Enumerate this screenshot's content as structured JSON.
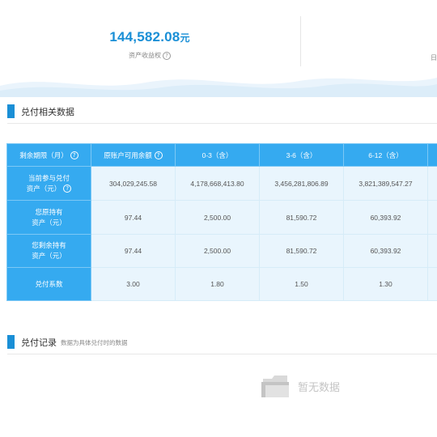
{
  "summary": {
    "amount": "144,582.08",
    "unit": "元",
    "label": "资产收益权",
    "right_stub": "日"
  },
  "sections": {
    "data_title": "兑付相关数据",
    "records_title": "兑付记录",
    "records_subtitle": "数据为具体兑付时的数据"
  },
  "table": {
    "headers": [
      "剩余期限（月）",
      "原账户可用余额",
      "0-3（含）",
      "3-6（含）",
      "6-12（含）",
      ""
    ],
    "rows": [
      {
        "label_line1": "当前参与兑付",
        "label_line2": "资产（元）",
        "values": [
          "304,029,245.58",
          "4,178,668,413.80",
          "3,456,281,806.89",
          "3,821,389,547.27",
          ""
        ]
      },
      {
        "label_line1": "您原持有",
        "label_line2": "资产（元）",
        "values": [
          "97.44",
          "2,500.00",
          "81,590.72",
          "60,393.92",
          ""
        ]
      },
      {
        "label_line1": "您剩余持有",
        "label_line2": "资产（元）",
        "values": [
          "97.44",
          "2,500.00",
          "81,590.72",
          "60,393.92",
          ""
        ]
      },
      {
        "label_line1": "兑付系数",
        "label_line2": "",
        "values": [
          "3.00",
          "1.80",
          "1.50",
          "1.30",
          ""
        ]
      }
    ]
  },
  "empty_state": {
    "text": "暂无数据",
    "icon": "folder-icon"
  },
  "colors": {
    "accent": "#1a8fd6",
    "table_header": "#35aaf0",
    "table_cell": "#e9f5fd"
  },
  "icons": {
    "help": "question-circle-icon",
    "section_marker": "blue-bar-icon"
  }
}
